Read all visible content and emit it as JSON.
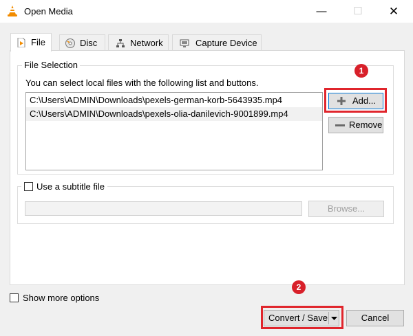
{
  "window": {
    "title": "Open Media",
    "minimize": "—",
    "maximize": "☐",
    "close": "✕"
  },
  "tabs": [
    {
      "label": "File",
      "icon": "file-play-icon",
      "active": true
    },
    {
      "label": "Disc",
      "icon": "disc-icon"
    },
    {
      "label": "Network",
      "icon": "network-icon"
    },
    {
      "label": "Capture Device",
      "icon": "capture-device-icon"
    }
  ],
  "file_selection": {
    "title": "File Selection",
    "description": "You can select local files with the following list and buttons.",
    "files": [
      "C:\\Users\\ADMIN\\Downloads\\pexels-german-korb-5643935.mp4",
      "C:\\Users\\ADMIN\\Downloads\\pexels-olia-danilevich-9001899.mp4"
    ],
    "add_label": "Add...",
    "remove_label": "Remove"
  },
  "subtitle": {
    "label": "Use a subtitle file",
    "checked": false,
    "path": "",
    "browse_label": "Browse..."
  },
  "show_more_options": {
    "label": "Show more options",
    "checked": false
  },
  "footer": {
    "convert_label": "Convert / Save",
    "cancel_label": "Cancel"
  },
  "annotations": [
    {
      "number": "1"
    },
    {
      "number": "2"
    }
  ],
  "colors": {
    "highlight": "#e0252c",
    "badge": "#d8202a"
  }
}
